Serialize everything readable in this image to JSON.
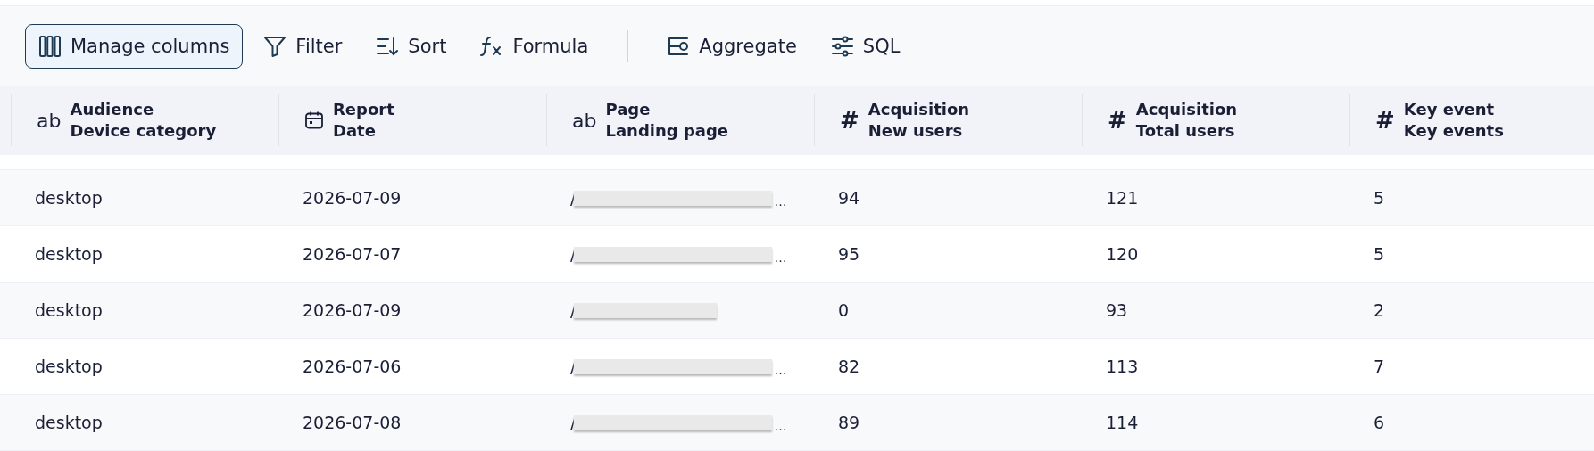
{
  "toolbar": [
    {
      "kind": "button",
      "label": "Manage columns",
      "selected": true
    },
    {
      "kind": "button",
      "label": "Filter",
      "selected": false
    },
    {
      "kind": "button",
      "label": "Sort",
      "selected": false
    },
    {
      "kind": "button",
      "label": "Formula",
      "selected": false
    },
    {
      "kind": "separator"
    },
    {
      "kind": "button",
      "label": "Aggregate",
      "selected": false
    },
    {
      "kind": "button",
      "label": "SQL",
      "selected": false
    }
  ],
  "table": {
    "columns": [
      {
        "kind": "text",
        "symbol": "ab",
        "group": "Audience",
        "name": "Device category"
      },
      {
        "kind": "date",
        "group": "Report",
        "name": "Date"
      },
      {
        "kind": "text",
        "symbol": "ab",
        "group": "Page",
        "name": "Landing page"
      },
      {
        "kind": "number",
        "symbol": "#",
        "group": "Acquisition",
        "name": "New users"
      },
      {
        "kind": "number",
        "symbol": "#",
        "group": "Acquisition",
        "name": "Total users"
      },
      {
        "kind": "number",
        "symbol": "#",
        "group": "Key event",
        "name": "Key events"
      }
    ],
    "rows": [
      {
        "device": "desktop",
        "date": "2026-07-09",
        "page": {
          "prefix": "/",
          "suffix": "…"
        },
        "new_users": "94",
        "total_users": "121",
        "key_events": "5"
      },
      {
        "device": "desktop",
        "date": "2026-07-07",
        "page": {
          "prefix": "/",
          "suffix": "…"
        },
        "new_users": "95",
        "total_users": "120",
        "key_events": "5"
      },
      {
        "device": "desktop",
        "date": "2026-07-09",
        "page": {
          "prefix": "/"
        },
        "new_users": "0",
        "total_users": "93",
        "key_events": "2"
      },
      {
        "device": "desktop",
        "date": "2026-07-06",
        "page": {
          "prefix": "/",
          "suffix": "…"
        },
        "new_users": "82",
        "total_users": "113",
        "key_events": "7"
      },
      {
        "device": "desktop",
        "date": "2026-07-08",
        "page": {
          "prefix": "/",
          "suffix": "…"
        },
        "new_users": "89",
        "total_users": "114",
        "key_events": "6"
      }
    ]
  }
}
